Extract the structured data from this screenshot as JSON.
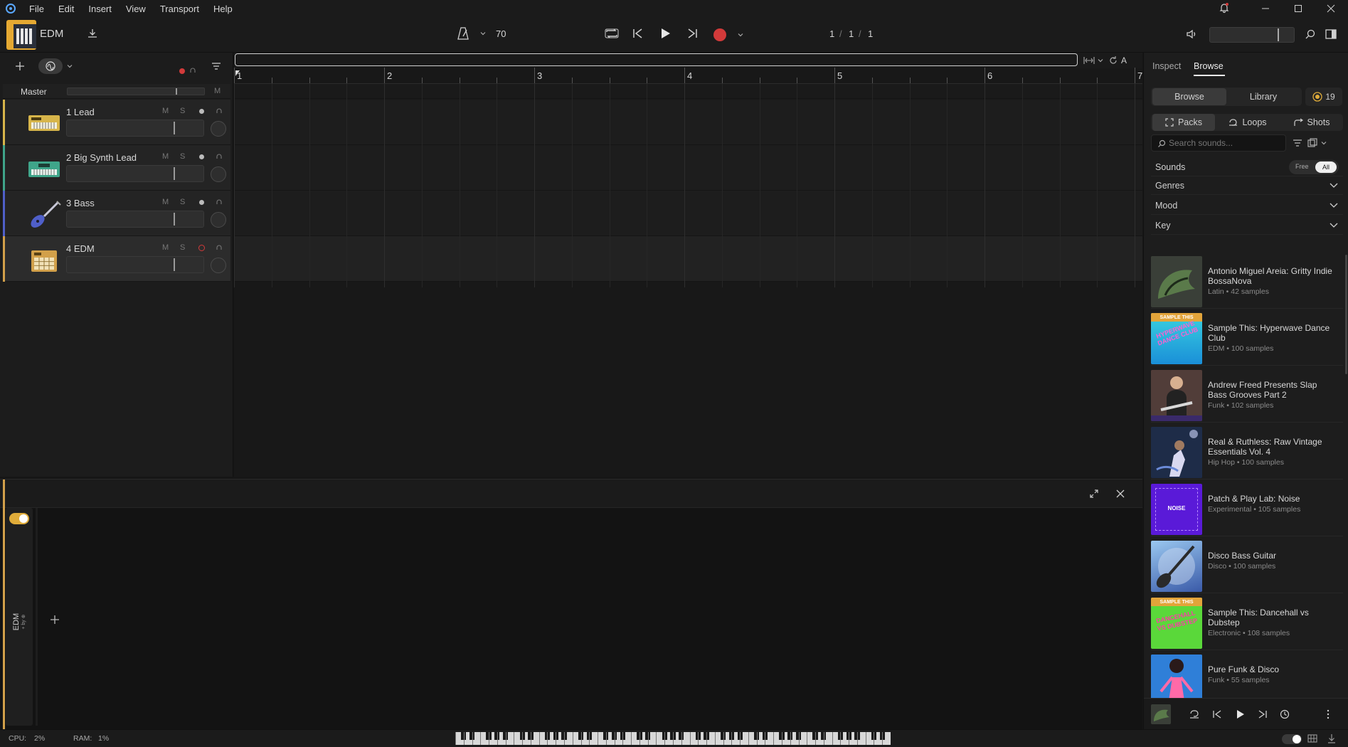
{
  "menu": {
    "items": [
      "File",
      "Edit",
      "Insert",
      "View",
      "Transport",
      "Help"
    ]
  },
  "project": {
    "name": "EDM"
  },
  "transport": {
    "tempo": "70",
    "position": [
      "1",
      "1",
      "1"
    ],
    "separator": "/"
  },
  "tracks_header": {
    "master_label": "Master",
    "master_m": "M"
  },
  "tracks": [
    {
      "number": "1",
      "name": "Lead",
      "m": "M",
      "s": "S",
      "color": "#d7b54a"
    },
    {
      "number": "2",
      "name": "Big Synth Lead",
      "m": "M",
      "s": "S",
      "color": "#3fa58a"
    },
    {
      "number": "3",
      "name": "Bass",
      "m": "M",
      "s": "S",
      "color": "#4f5fc9"
    },
    {
      "number": "4",
      "name": "EDM",
      "m": "M",
      "s": "S",
      "color": "#d2a04a"
    }
  ],
  "ruler": {
    "bars": [
      "1",
      "2",
      "3",
      "4",
      "5",
      "6",
      "7"
    ],
    "loop_label": "A"
  },
  "device_panel": {
    "track_label": "EDM",
    "sub_label": "+ by ⊕"
  },
  "right_panel": {
    "tabs": [
      "Inspect",
      "Browse"
    ],
    "segment": [
      "Browse",
      "Library"
    ],
    "credits": "19",
    "categories": [
      "Packs",
      "Loops",
      "Shots"
    ],
    "search_placeholder": "Search sounds...",
    "sounds_label": "Sounds",
    "toggle": [
      "Free",
      "All"
    ],
    "filters": [
      "Genres",
      "Mood",
      "Key"
    ],
    "packs": [
      {
        "title": "Antonio Miguel Areia: Gritty Indie BossaNova",
        "meta": "Latin • 42 samples"
      },
      {
        "title": "Sample This: Hyperwave Dance Club",
        "meta": "EDM • 100 samples"
      },
      {
        "title": "Andrew Freed Presents Slap Bass Grooves Part 2",
        "meta": "Funk • 102 samples"
      },
      {
        "title": "Real & Ruthless: Raw Vintage Essentials Vol. 4",
        "meta": "Hip Hop • 100 samples"
      },
      {
        "title": "Patch & Play Lab: Noise",
        "meta": "Experimental • 105 samples"
      },
      {
        "title": "Disco Bass Guitar",
        "meta": "Disco • 100 samples"
      },
      {
        "title": "Sample This: Dancehall vs Dubstep",
        "meta": "Electronic • 108 samples"
      },
      {
        "title": "Pure Funk & Disco",
        "meta": "Funk • 55 samples"
      }
    ],
    "thumb_text": [
      "SAMPLE THIS",
      "HYPERWAVE DANCE CLUB",
      "NOISE",
      "SAMPLE THIS",
      "DANCEHALL VS DUBSTEP"
    ]
  },
  "status": {
    "cpu_label": "CPU:",
    "cpu_value": "2%",
    "ram_label": "RAM:",
    "ram_value": "1%"
  },
  "colors": {
    "accent": "#d7a93a",
    "record": "#d23a3a",
    "panel": "#1d1d1d"
  }
}
